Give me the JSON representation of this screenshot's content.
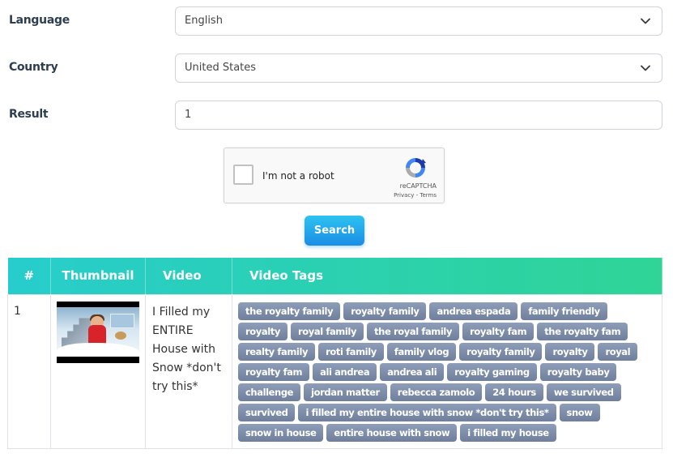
{
  "form": {
    "language": {
      "label": "Language",
      "value": "English"
    },
    "country": {
      "label": "Country",
      "value": "United States"
    },
    "result": {
      "label": "Result",
      "value": "1"
    }
  },
  "captcha": {
    "label": "I'm not a robot",
    "brand": "reCAPTCHA",
    "links": "Privacy - Terms",
    "checked": false
  },
  "search_button": {
    "label": "Search"
  },
  "table": {
    "headers": {
      "num": "#",
      "thumbnail": "Thumbnail",
      "video": "Video",
      "tags": "Video Tags"
    },
    "header_gradient": [
      "#27cdcc",
      "#2fd496"
    ],
    "rows": [
      {
        "num": "1",
        "thumbnail_icon": "video-thumbnail-snow-house",
        "video_title": "I Filled my ENTIRE House with Snow *don't try this*",
        "tags": [
          "the royalty family",
          "royalty family",
          "andrea espada",
          "family friendly",
          "royalty",
          "royal family",
          "the royal family",
          "royalty fam",
          "the royalty fam",
          "realty family",
          "roti family",
          "family vlog",
          "royalty family",
          "royalty",
          "royal",
          "royalty fam",
          "ali andrea",
          "andrea ali",
          "royalty gaming",
          "royalty baby",
          "challenge",
          "jordan matter",
          "rebecca zamolo",
          "24 hours",
          "we survived",
          "survived",
          "i filled my entire house with snow *don't try this*",
          "snow",
          "snow in house",
          "entire house with snow",
          "i filled my house"
        ]
      }
    ]
  },
  "colors": {
    "tag_bg": "#7f8eab",
    "search_button": "#1a8de6",
    "label_text": "#2c3e50"
  }
}
